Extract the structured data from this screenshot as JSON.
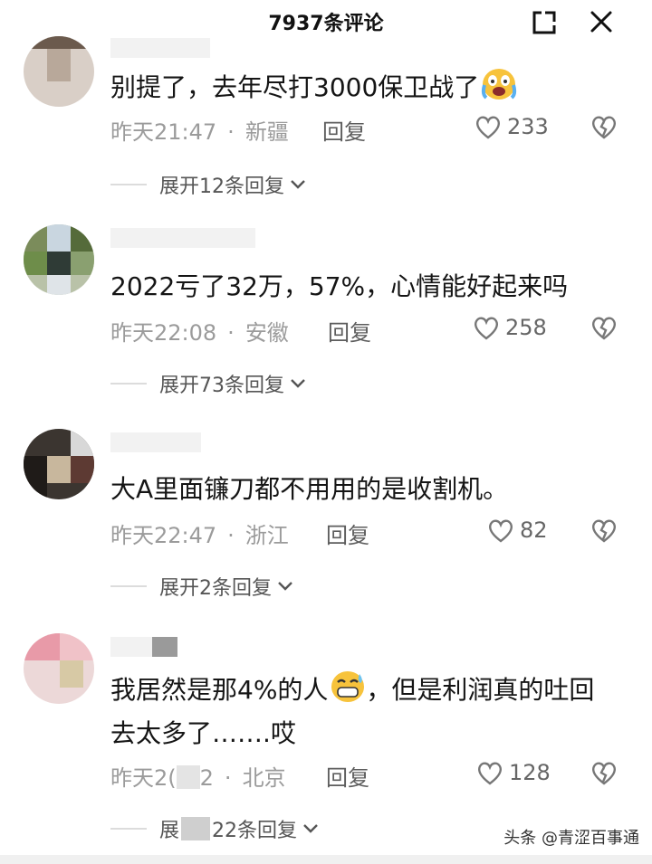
{
  "header": {
    "title": "7937条评论",
    "icons": {
      "expand": "expand-icon",
      "close": "close-icon"
    }
  },
  "comments": [
    {
      "text": "别提了，去年尽打3000保卫战了",
      "emoji": "crying-face-emoji",
      "time": "昨天21:47",
      "dot": "·",
      "location": "新疆",
      "reply_label": "回复",
      "likes": "233",
      "expand_label": "展开12条回复"
    },
    {
      "text": "2022亏了32万，57%，心情能好起来吗",
      "time": "昨天22:08",
      "dot": "·",
      "location": "安徽",
      "reply_label": "回复",
      "likes": "258",
      "expand_label": "展开73条回复"
    },
    {
      "text": "大A里面镰刀都不用用的是收割机。",
      "time": "昨天22:47",
      "dot": "·",
      "location": "浙江",
      "reply_label": "回复",
      "likes": "82",
      "expand_label": "展开2条回复"
    },
    {
      "text_before_emoji": "我居然是那4%的人",
      "emoji": "grinning-sweat-emoji",
      "text_after_emoji": "，但是利润真的吐回",
      "text_line2": "去太多了…….哎",
      "time_partial": "昨天2(",
      "time_end": "2",
      "dot": "·",
      "location": "北京",
      "reply_label": "回复",
      "likes": "128",
      "expand_label_start": "展",
      "expand_label_end": "22条回复"
    }
  ],
  "watermark": "头条 @青涩百事通",
  "colors": {
    "text": "#151515",
    "meta": "#9b9b9b",
    "reply": "#5d5d5d",
    "mosaic_gray": "#c8c8c8",
    "emoji_yellow": "#f7c33c"
  }
}
